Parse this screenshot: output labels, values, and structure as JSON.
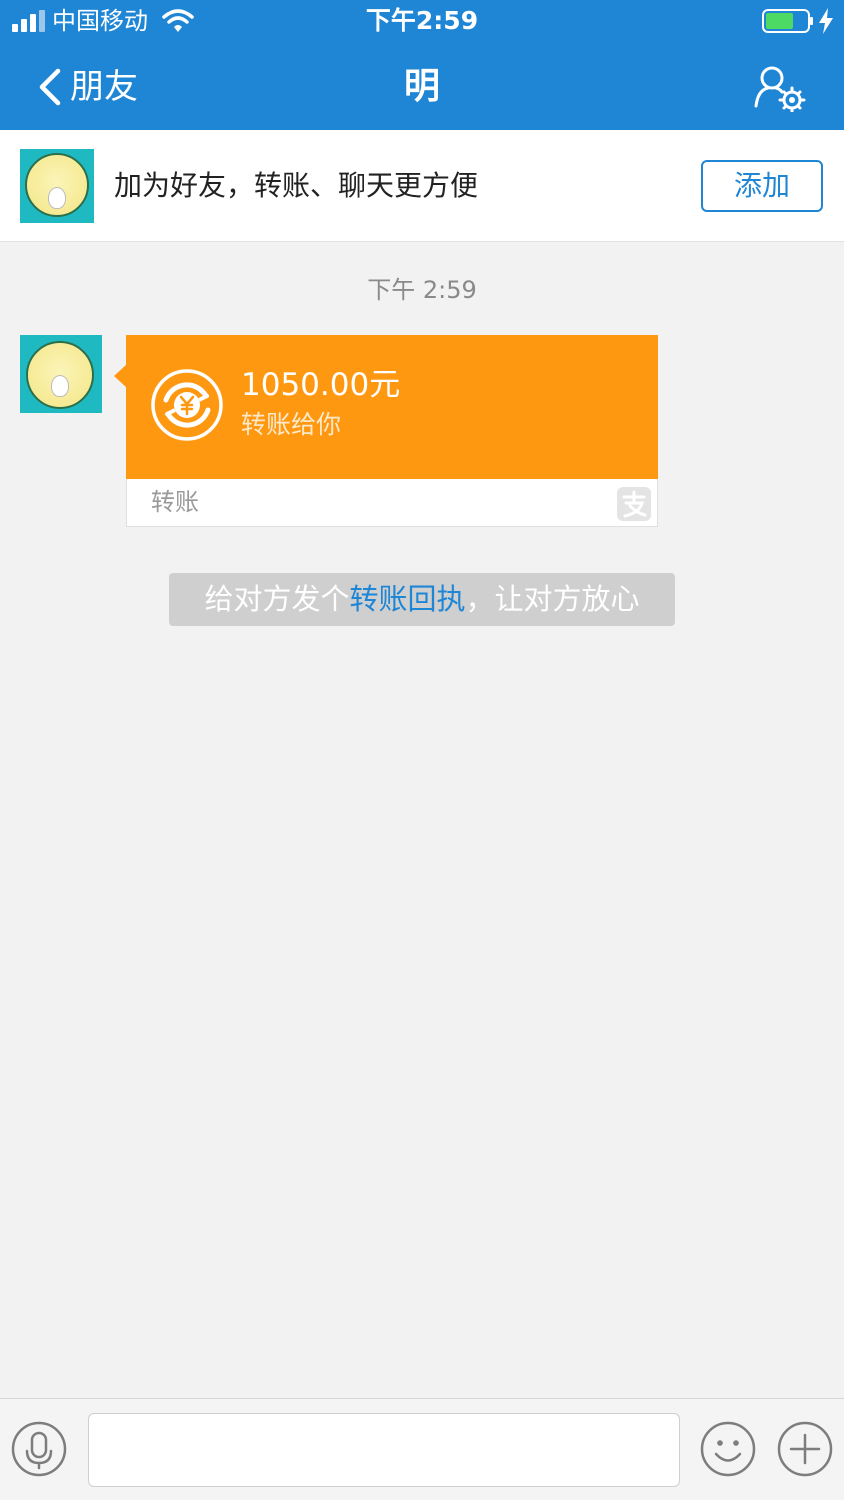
{
  "status_bar": {
    "carrier": "中国移动",
    "time": "下午2:59"
  },
  "nav": {
    "back_label": "朋友",
    "title": "明"
  },
  "banner": {
    "text": "加为好友，转账、聊天更方便",
    "add_label": "添加"
  },
  "chat": {
    "timestamp": "下午 2:59",
    "transfer": {
      "amount": "1050.00元",
      "subtitle": "转账给你",
      "label": "转账"
    },
    "hint": {
      "prefix": "给对方发个",
      "link": "转账回执",
      "suffix": "，让对方放心"
    }
  },
  "input": {
    "value": "",
    "placeholder": ""
  },
  "colors": {
    "header_blue": "#1f86d6",
    "transfer_orange": "#ff9811",
    "background": "#f2f2f2",
    "battery_green": "#4cd964"
  }
}
